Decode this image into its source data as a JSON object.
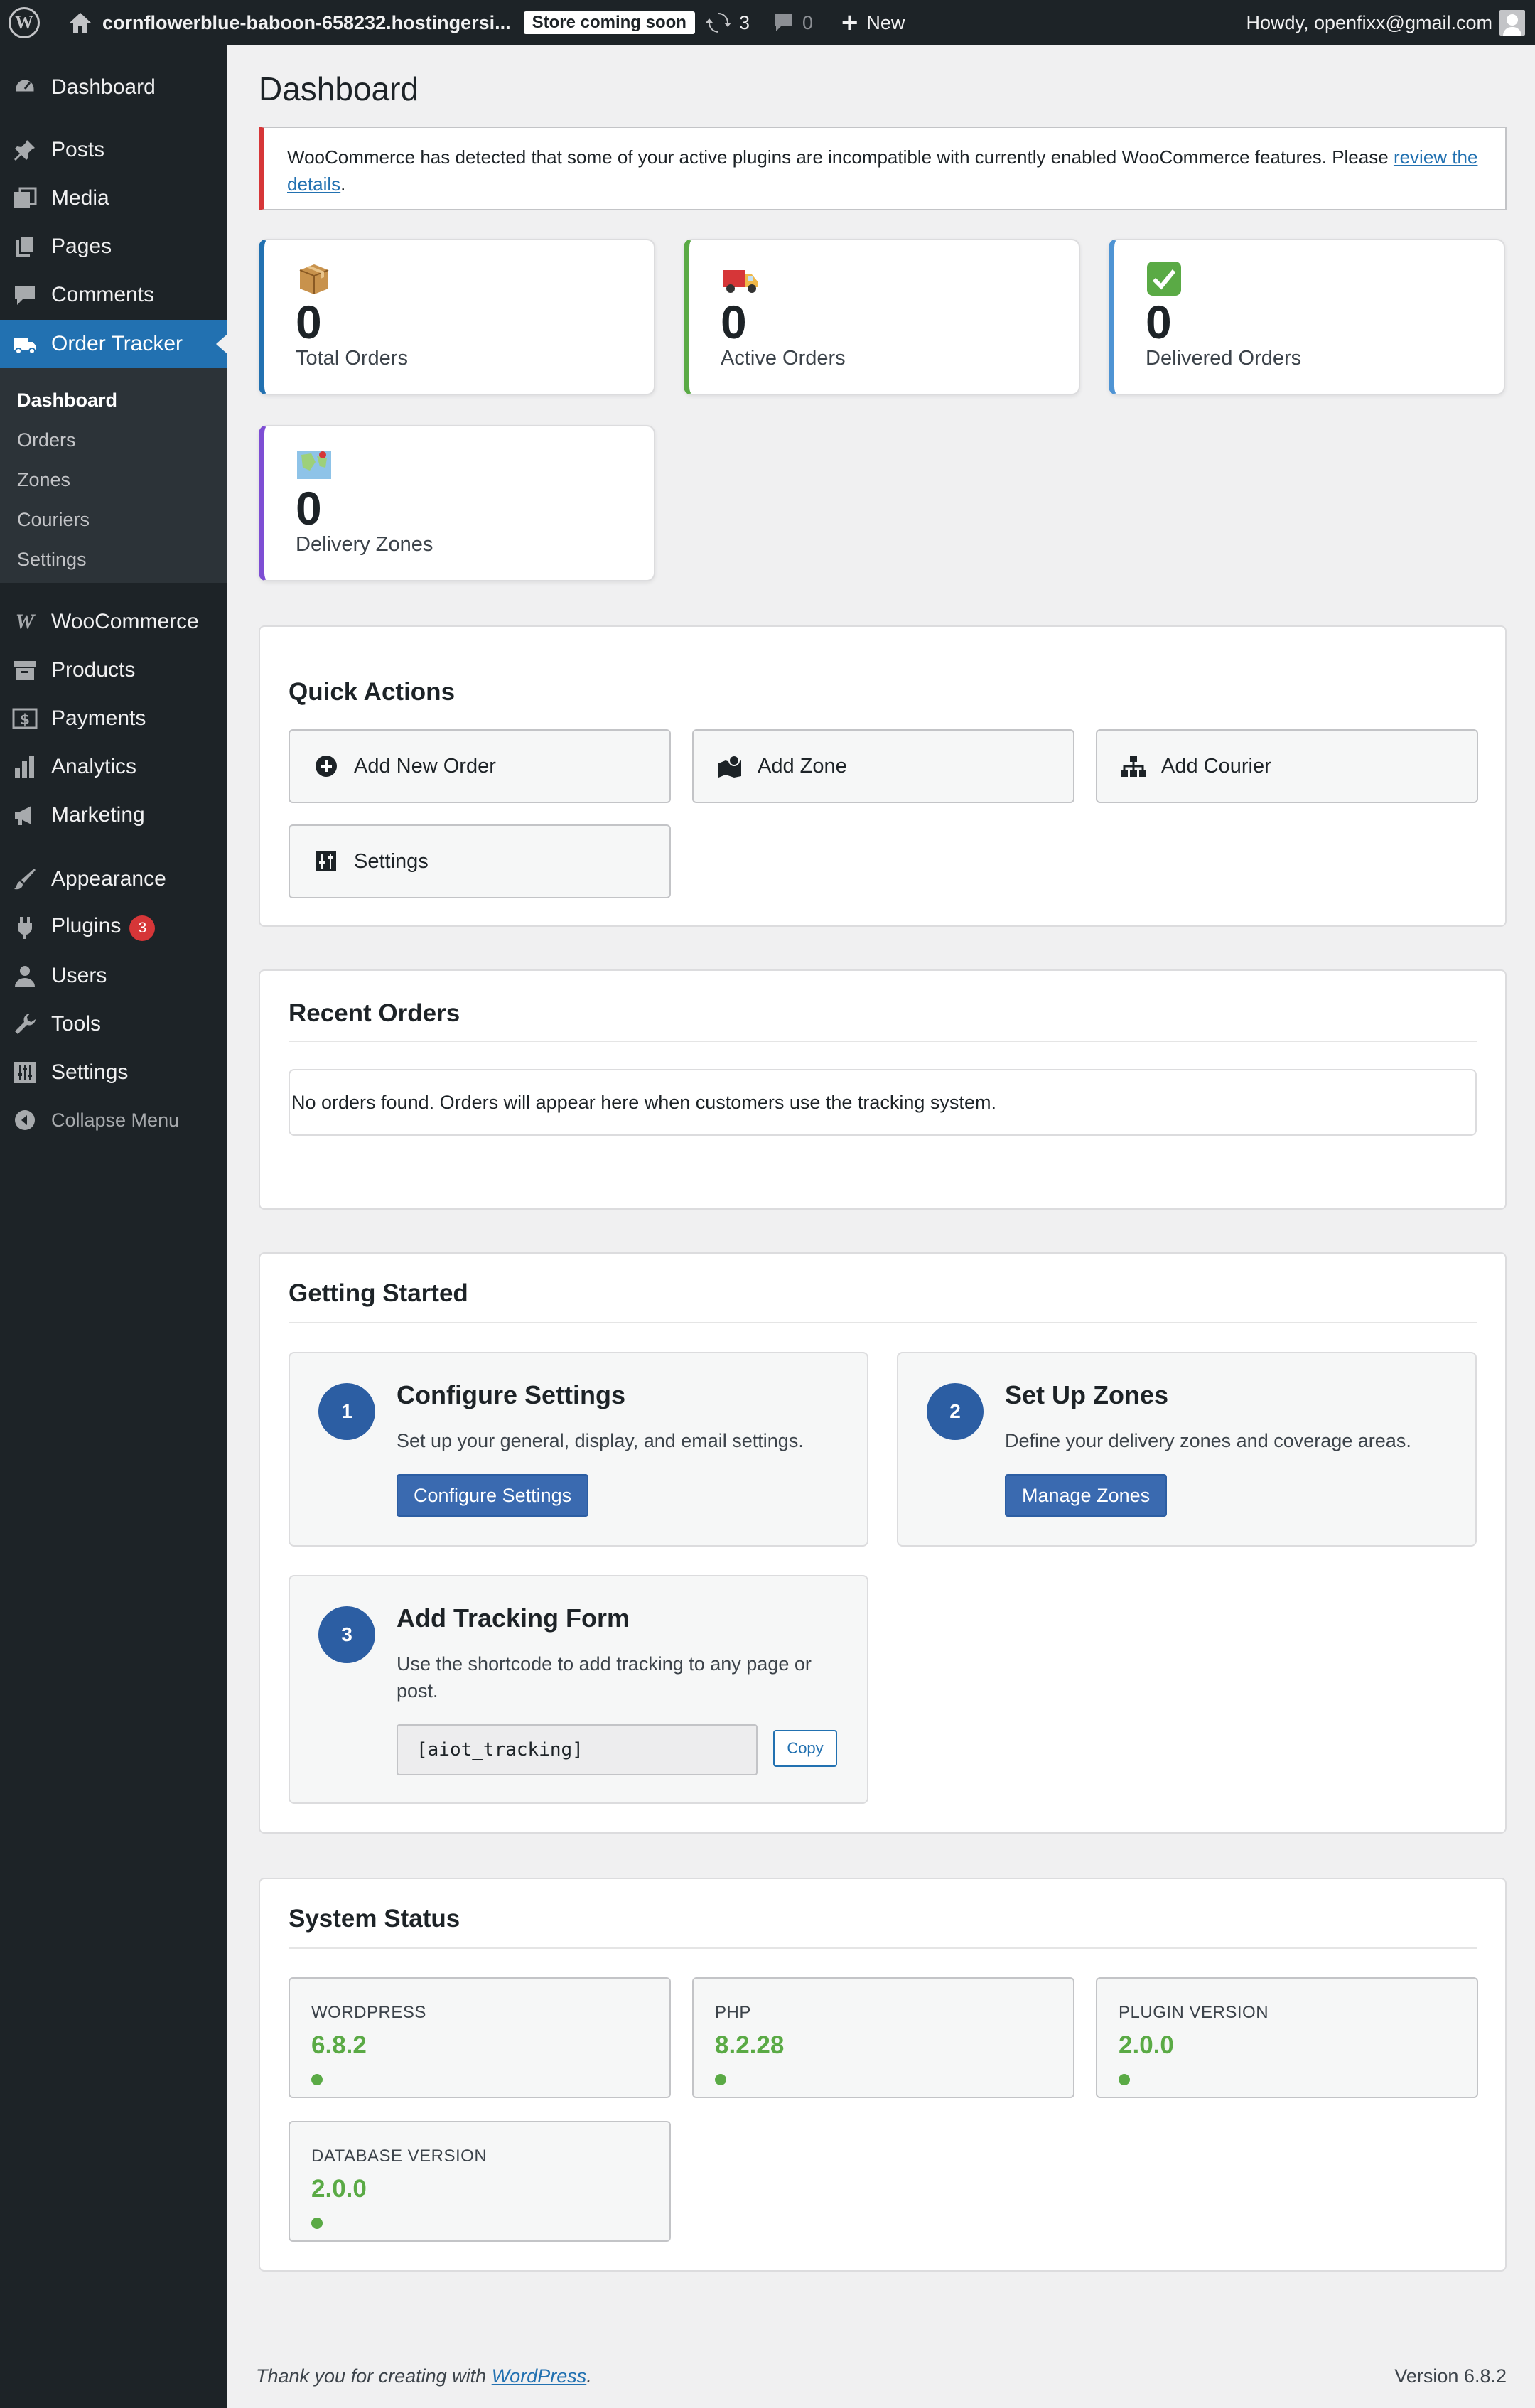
{
  "adminbar": {
    "site_name": "cornflowerblue-baboon-658232.hostingersi...",
    "badge": "Store coming soon",
    "updates_count": "3",
    "comments_count": "0",
    "new_label": "New",
    "howdy": "Howdy, openfixx@gmail.com"
  },
  "sidebar": {
    "items": [
      {
        "label": "Dashboard",
        "icon": "dashboard-icon"
      },
      {
        "label": "Posts",
        "icon": "pushpin-icon"
      },
      {
        "label": "Media",
        "icon": "media-icon"
      },
      {
        "label": "Pages",
        "icon": "pages-icon"
      },
      {
        "label": "Comments",
        "icon": "comment-icon"
      },
      {
        "label": "Order Tracker",
        "icon": "truck-icon"
      },
      {
        "label": "WooCommerce",
        "icon": "woo-icon"
      },
      {
        "label": "Products",
        "icon": "archive-icon"
      },
      {
        "label": "Payments",
        "icon": "dollar-icon"
      },
      {
        "label": "Analytics",
        "icon": "bar-chart-icon"
      },
      {
        "label": "Marketing",
        "icon": "megaphone-icon"
      },
      {
        "label": "Appearance",
        "icon": "brush-icon"
      },
      {
        "label": "Plugins",
        "icon": "plug-icon"
      },
      {
        "label": "Users",
        "icon": "user-icon"
      },
      {
        "label": "Tools",
        "icon": "wrench-icon"
      },
      {
        "label": "Settings",
        "icon": "sliders-icon"
      }
    ],
    "plugins_badge": "3",
    "submenu": [
      "Dashboard",
      "Orders",
      "Zones",
      "Couriers",
      "Settings"
    ],
    "collapse_label": "Collapse Menu"
  },
  "main": {
    "title": "Dashboard",
    "notice_text": "WooCommerce has detected that some of your active plugins are incompatible with currently enabled WooCommerce features. Please",
    "notice_link": "review the details",
    "notice_end": ".",
    "stats": [
      {
        "value": "0",
        "label": "Total Orders",
        "icon": "package-icon",
        "color": "#2271b1"
      },
      {
        "value": "0",
        "label": "Active Orders",
        "icon": "delivery-truck-icon",
        "color": "#5aaa45"
      },
      {
        "value": "0",
        "label": "Delivered Orders",
        "icon": "check-mark-icon",
        "color": "#4f94d4"
      },
      {
        "value": "0",
        "label": "Delivery Zones",
        "icon": "map-icon",
        "color": "#7e4ed4"
      }
    ],
    "quick_actions": {
      "title": "Quick Actions",
      "buttons": [
        "Add New Order",
        "Add Zone",
        "Add Courier",
        "Settings"
      ]
    },
    "recent_orders": {
      "title": "Recent Orders",
      "empty": "No orders found. Orders will appear here when customers use the tracking system."
    },
    "getting_started": {
      "title": "Getting Started",
      "steps": [
        {
          "num": "1",
          "title": "Configure Settings",
          "desc": "Set up your general, display, and email settings.",
          "button": "Configure Settings"
        },
        {
          "num": "2",
          "title": "Set Up Zones",
          "desc": "Define your delivery zones and coverage areas.",
          "button": "Manage Zones"
        },
        {
          "num": "3",
          "title": "Add Tracking Form",
          "desc": "Use the shortcode to add tracking to any page or post.",
          "shortcode": "[aiot_tracking]",
          "copy": "Copy"
        }
      ]
    },
    "system_status": {
      "title": "System Status",
      "items": [
        {
          "label": "WORDPRESS",
          "value": "6.8.2"
        },
        {
          "label": "PHP",
          "value": "8.2.28"
        },
        {
          "label": "PLUGIN VERSION",
          "value": "2.0.0"
        },
        {
          "label": "DATABASE VERSION",
          "value": "2.0.0"
        }
      ],
      "ok_color": "#5aaa45"
    }
  },
  "footer": {
    "thanks": "Thank you for creating with",
    "link": "WordPress",
    "end": ".",
    "version": "Version 6.8.2"
  }
}
